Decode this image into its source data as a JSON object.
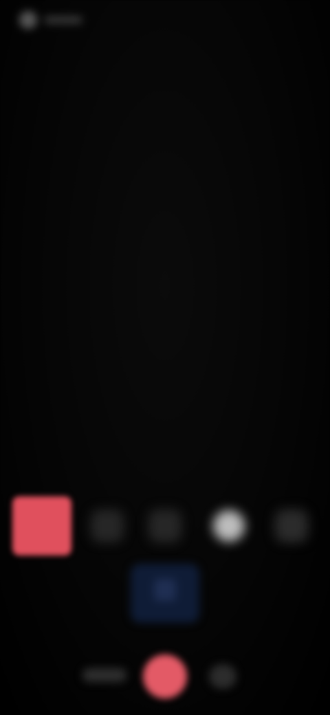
{
  "status": {
    "text": ""
  },
  "toolbar": {
    "record_icon": "record-icon",
    "tool_2_icon": "tool-icon",
    "tool_3_icon": "tool-icon",
    "tool_4_icon": "light-icon",
    "tool_5_icon": "tool-icon"
  },
  "center_badge": {
    "icon": "badge-icon"
  },
  "bottom_bar": {
    "left_label": "",
    "center_icon": "capture-icon",
    "right_icon": "more-icon"
  },
  "colors": {
    "background": "#000000",
    "accent_red": "#e0505d",
    "badge_blue": "#0f1c36",
    "light_grey": "#bdbdbd",
    "dark_grey": "#262626"
  }
}
